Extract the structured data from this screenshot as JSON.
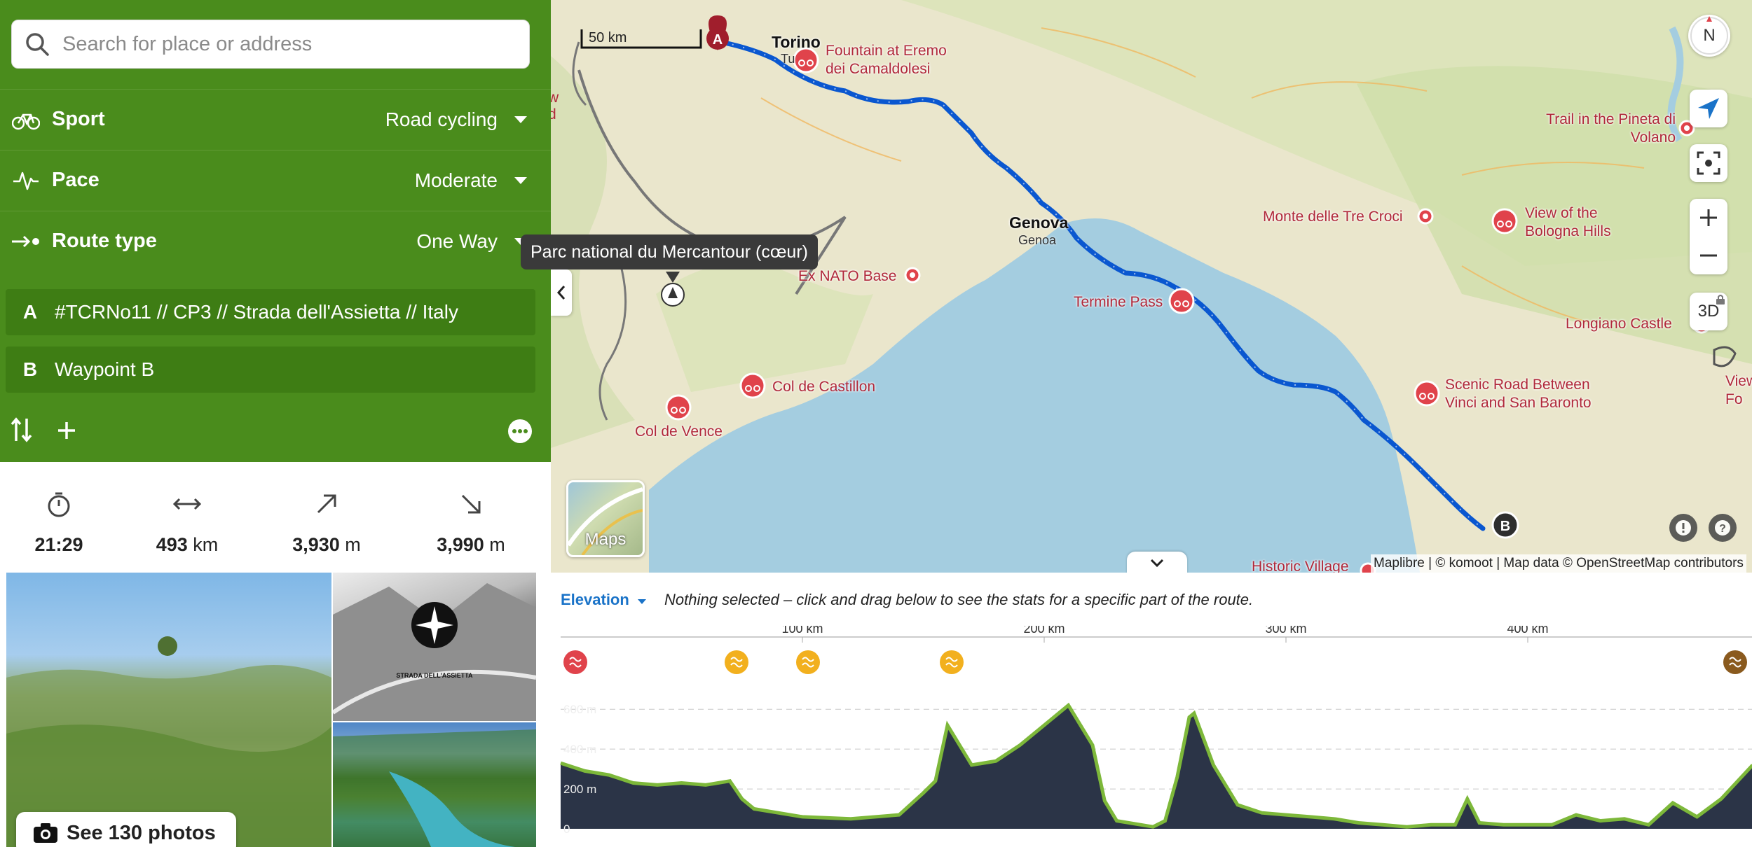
{
  "search": {
    "placeholder": "Search for place or address"
  },
  "options": {
    "sport": {
      "label": "Sport",
      "value": "Road cycling",
      "icon": "bicycle-icon"
    },
    "pace": {
      "label": "Pace",
      "value": "Moderate",
      "icon": "pulse-icon"
    },
    "route_type": {
      "label": "Route type",
      "value": "One Way",
      "icon": "one-way-icon"
    }
  },
  "waypoints": [
    {
      "letter": "A",
      "name": "#TCRNo11 // CP3 // Strada dell'Assietta // Italy"
    },
    {
      "letter": "B",
      "name": "Waypoint B"
    }
  ],
  "stats": {
    "duration": "21:29",
    "distance_value": "493",
    "distance_unit": "km",
    "ascent_value": "3,930",
    "ascent_unit": "m",
    "descent_value": "3,990",
    "descent_unit": "m"
  },
  "photos": {
    "see_label": "See 130 photos",
    "overlay_text": "STRADA DELL'ASSIETTA"
  },
  "map": {
    "scale_label": "50 km",
    "tooltip": "Parc national du Mercantour (cœur)",
    "layer_label": "Maps",
    "three_d_label": "3D",
    "compass_label": "N",
    "attribution": "Maplibre | © komoot | Map data © OpenStreetMap contributors",
    "route_color": "#0a57d0",
    "poi_color": "#e0434b",
    "cities": [
      {
        "name": "Torino",
        "sub": "Tu"
      },
      {
        "name": "Genova",
        "sub": "Genoa"
      }
    ],
    "pois": [
      "Fountain at Eremo dei Camaldolesi",
      "Ex NATO Base",
      "Col de Castillon",
      "Col de Vence",
      "Termine Pass",
      "Monte delle Tre Croci",
      "View of the Bologna Hills",
      "Trail in the Pineta di Volano",
      "Longiano Castle",
      "Scenic Road Between Vinci and San Baronto",
      "Historic Village",
      "View Fo"
    ],
    "partial_label": "w d"
  },
  "elevation": {
    "tab_label": "Elevation",
    "message": "Nothing selected – click and drag below to see the stats for a specific part of the route.",
    "x_ticks": [
      "100 km",
      "200 km",
      "300 km",
      "400 km"
    ],
    "y_ticks": [
      "600 m",
      "400 m",
      "200 m",
      "0"
    ],
    "fill_color": "#2b3447",
    "line_color": "#7db83a",
    "profile_km": [
      0,
      10,
      20,
      30,
      40,
      50,
      60,
      70,
      75,
      80,
      90,
      100,
      120,
      140,
      150,
      155,
      160,
      170,
      180,
      190,
      200,
      210,
      220,
      225,
      230,
      240,
      245,
      250,
      255,
      260,
      262,
      270,
      280,
      290,
      300,
      310,
      320,
      330,
      340,
      350,
      360,
      370,
      375,
      380,
      390,
      400,
      410,
      420,
      430,
      440,
      450,
      460,
      470,
      480,
      493
    ],
    "profile_m": [
      330,
      290,
      270,
      230,
      220,
      230,
      220,
      240,
      150,
      100,
      80,
      60,
      50,
      70,
      180,
      240,
      520,
      320,
      340,
      420,
      520,
      620,
      420,
      140,
      40,
      20,
      10,
      40,
      260,
      560,
      580,
      320,
      120,
      80,
      70,
      60,
      50,
      30,
      20,
      10,
      20,
      20,
      150,
      30,
      20,
      20,
      20,
      70,
      40,
      50,
      20,
      130,
      60,
      150,
      320
    ]
  }
}
